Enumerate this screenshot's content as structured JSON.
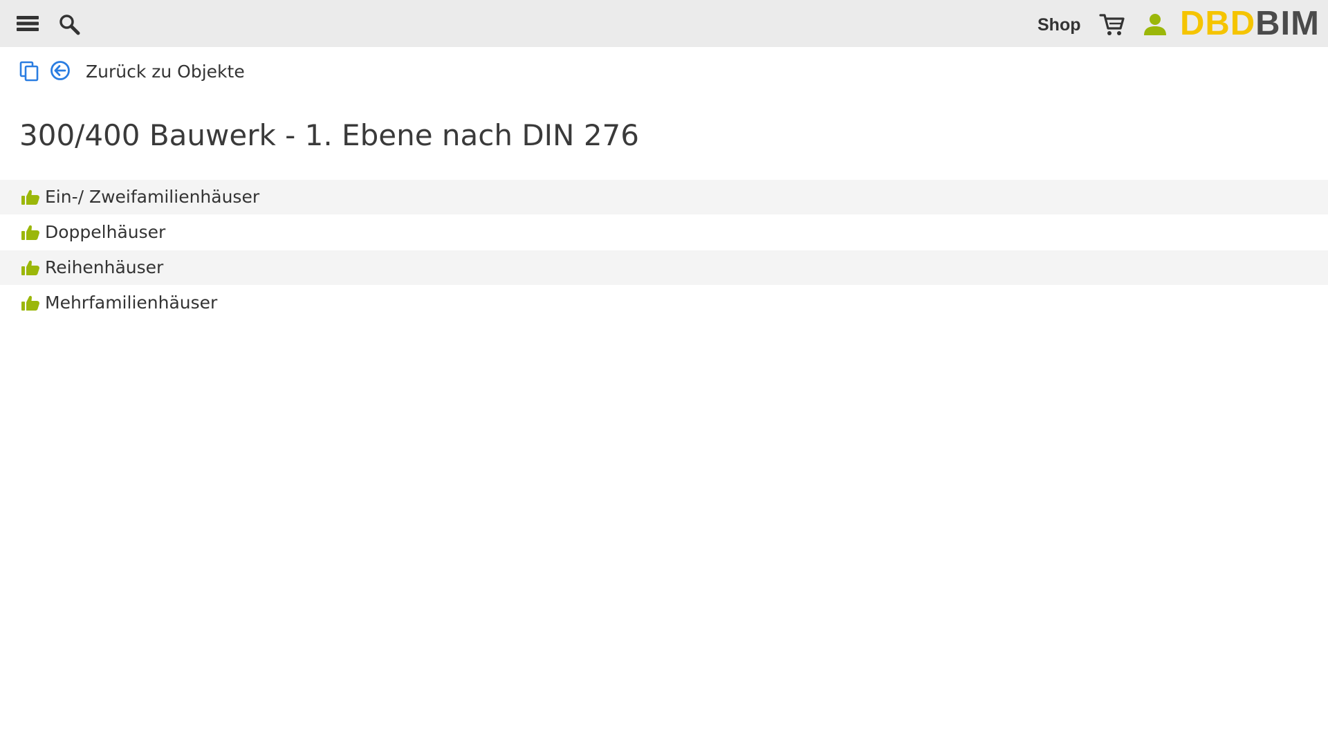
{
  "header": {
    "menu_icon": "hamburger-menu-icon",
    "search_icon": "search-icon",
    "shop_label": "Shop",
    "cart_icon": "shopping-cart-icon",
    "user_icon": "user-icon",
    "logo": {
      "part1": "DBD",
      "part2": "BIM"
    },
    "colors": {
      "bar": "#ebebeb",
      "logo_accent": "#f5c400",
      "logo_dark": "#4a4a4a",
      "user_icon": "#9bb70a"
    }
  },
  "nav": {
    "copy_icon": "copy-icon",
    "back_icon": "arrow-left-circle-icon",
    "back_label": "Zurück zu Objekte",
    "icon_color": "#2a7de1"
  },
  "main": {
    "title": "300/400 Bauwerk - 1. Ebene nach DIN 276",
    "items": [
      {
        "label": "Ein-/ Zweifamilienhäuser",
        "icon": "thumbs-up-icon"
      },
      {
        "label": "Doppelhäuser",
        "icon": "thumbs-up-icon"
      },
      {
        "label": "Reihenhäuser",
        "icon": "thumbs-up-icon"
      },
      {
        "label": "Mehrfamilienhäuser",
        "icon": "thumbs-up-icon"
      }
    ],
    "item_icon_color": "#9bb70a"
  }
}
